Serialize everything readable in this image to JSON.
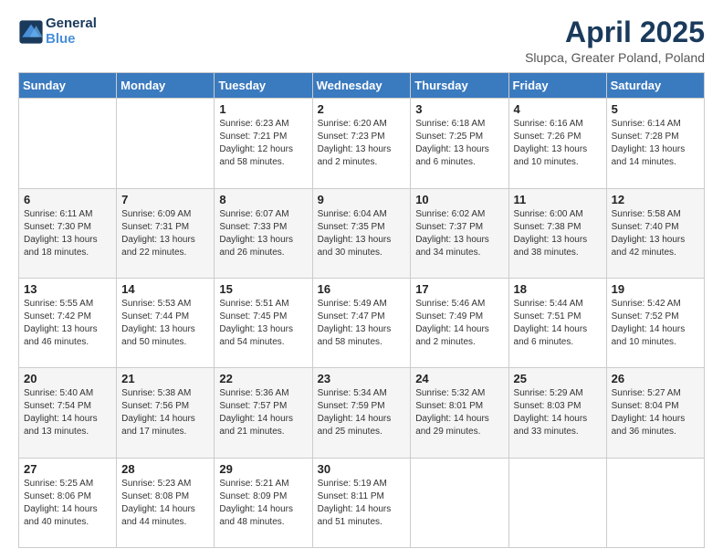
{
  "logo": {
    "line1": "General",
    "line2": "Blue"
  },
  "header": {
    "title": "April 2025",
    "subtitle": "Slupca, Greater Poland, Poland"
  },
  "days_of_week": [
    "Sunday",
    "Monday",
    "Tuesday",
    "Wednesday",
    "Thursday",
    "Friday",
    "Saturday"
  ],
  "weeks": [
    [
      {
        "day": "",
        "info": ""
      },
      {
        "day": "",
        "info": ""
      },
      {
        "day": "1",
        "info": "Sunrise: 6:23 AM\nSunset: 7:21 PM\nDaylight: 12 hours and 58 minutes."
      },
      {
        "day": "2",
        "info": "Sunrise: 6:20 AM\nSunset: 7:23 PM\nDaylight: 13 hours and 2 minutes."
      },
      {
        "day": "3",
        "info": "Sunrise: 6:18 AM\nSunset: 7:25 PM\nDaylight: 13 hours and 6 minutes."
      },
      {
        "day": "4",
        "info": "Sunrise: 6:16 AM\nSunset: 7:26 PM\nDaylight: 13 hours and 10 minutes."
      },
      {
        "day": "5",
        "info": "Sunrise: 6:14 AM\nSunset: 7:28 PM\nDaylight: 13 hours and 14 minutes."
      }
    ],
    [
      {
        "day": "6",
        "info": "Sunrise: 6:11 AM\nSunset: 7:30 PM\nDaylight: 13 hours and 18 minutes."
      },
      {
        "day": "7",
        "info": "Sunrise: 6:09 AM\nSunset: 7:31 PM\nDaylight: 13 hours and 22 minutes."
      },
      {
        "day": "8",
        "info": "Sunrise: 6:07 AM\nSunset: 7:33 PM\nDaylight: 13 hours and 26 minutes."
      },
      {
        "day": "9",
        "info": "Sunrise: 6:04 AM\nSunset: 7:35 PM\nDaylight: 13 hours and 30 minutes."
      },
      {
        "day": "10",
        "info": "Sunrise: 6:02 AM\nSunset: 7:37 PM\nDaylight: 13 hours and 34 minutes."
      },
      {
        "day": "11",
        "info": "Sunrise: 6:00 AM\nSunset: 7:38 PM\nDaylight: 13 hours and 38 minutes."
      },
      {
        "day": "12",
        "info": "Sunrise: 5:58 AM\nSunset: 7:40 PM\nDaylight: 13 hours and 42 minutes."
      }
    ],
    [
      {
        "day": "13",
        "info": "Sunrise: 5:55 AM\nSunset: 7:42 PM\nDaylight: 13 hours and 46 minutes."
      },
      {
        "day": "14",
        "info": "Sunrise: 5:53 AM\nSunset: 7:44 PM\nDaylight: 13 hours and 50 minutes."
      },
      {
        "day": "15",
        "info": "Sunrise: 5:51 AM\nSunset: 7:45 PM\nDaylight: 13 hours and 54 minutes."
      },
      {
        "day": "16",
        "info": "Sunrise: 5:49 AM\nSunset: 7:47 PM\nDaylight: 13 hours and 58 minutes."
      },
      {
        "day": "17",
        "info": "Sunrise: 5:46 AM\nSunset: 7:49 PM\nDaylight: 14 hours and 2 minutes."
      },
      {
        "day": "18",
        "info": "Sunrise: 5:44 AM\nSunset: 7:51 PM\nDaylight: 14 hours and 6 minutes."
      },
      {
        "day": "19",
        "info": "Sunrise: 5:42 AM\nSunset: 7:52 PM\nDaylight: 14 hours and 10 minutes."
      }
    ],
    [
      {
        "day": "20",
        "info": "Sunrise: 5:40 AM\nSunset: 7:54 PM\nDaylight: 14 hours and 13 minutes."
      },
      {
        "day": "21",
        "info": "Sunrise: 5:38 AM\nSunset: 7:56 PM\nDaylight: 14 hours and 17 minutes."
      },
      {
        "day": "22",
        "info": "Sunrise: 5:36 AM\nSunset: 7:57 PM\nDaylight: 14 hours and 21 minutes."
      },
      {
        "day": "23",
        "info": "Sunrise: 5:34 AM\nSunset: 7:59 PM\nDaylight: 14 hours and 25 minutes."
      },
      {
        "day": "24",
        "info": "Sunrise: 5:32 AM\nSunset: 8:01 PM\nDaylight: 14 hours and 29 minutes."
      },
      {
        "day": "25",
        "info": "Sunrise: 5:29 AM\nSunset: 8:03 PM\nDaylight: 14 hours and 33 minutes."
      },
      {
        "day": "26",
        "info": "Sunrise: 5:27 AM\nSunset: 8:04 PM\nDaylight: 14 hours and 36 minutes."
      }
    ],
    [
      {
        "day": "27",
        "info": "Sunrise: 5:25 AM\nSunset: 8:06 PM\nDaylight: 14 hours and 40 minutes."
      },
      {
        "day": "28",
        "info": "Sunrise: 5:23 AM\nSunset: 8:08 PM\nDaylight: 14 hours and 44 minutes."
      },
      {
        "day": "29",
        "info": "Sunrise: 5:21 AM\nSunset: 8:09 PM\nDaylight: 14 hours and 48 minutes."
      },
      {
        "day": "30",
        "info": "Sunrise: 5:19 AM\nSunset: 8:11 PM\nDaylight: 14 hours and 51 minutes."
      },
      {
        "day": "",
        "info": ""
      },
      {
        "day": "",
        "info": ""
      },
      {
        "day": "",
        "info": ""
      }
    ]
  ]
}
